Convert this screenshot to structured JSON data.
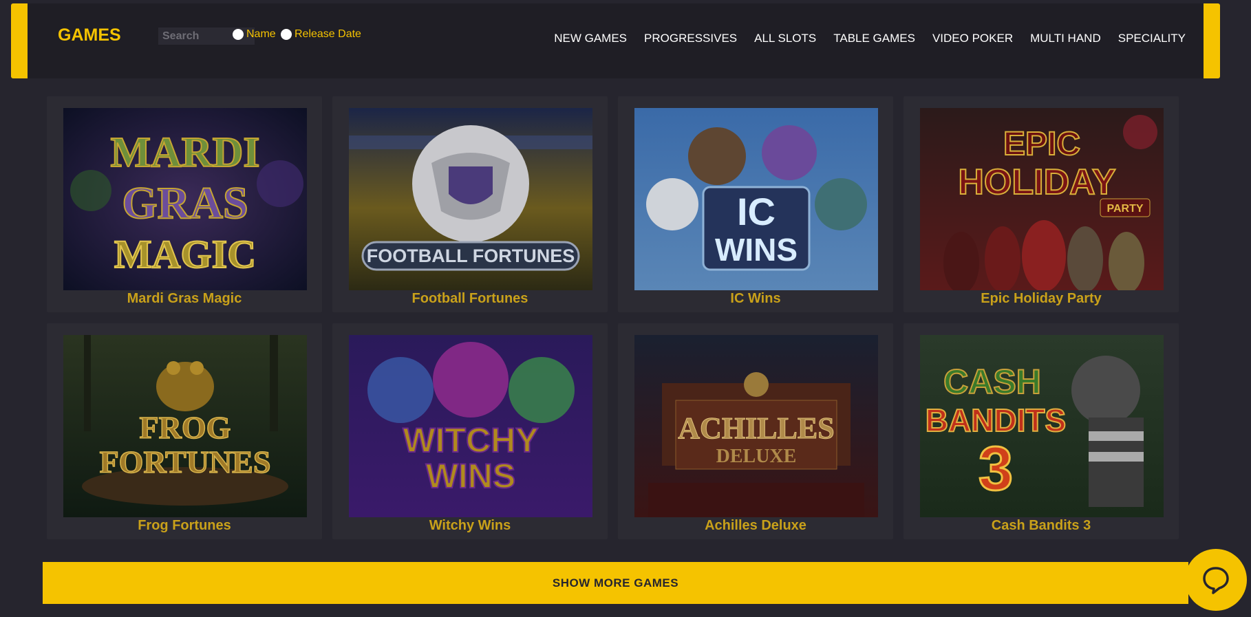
{
  "header": {
    "brand": "GAMES",
    "search_placeholder": "Search",
    "sort_options": [
      {
        "label": "Name"
      },
      {
        "label": "Release Date"
      }
    ],
    "nav": [
      "NEW GAMES",
      "PROGRESSIVES",
      "ALL SLOTS",
      "TABLE GAMES",
      "VIDEO POKER",
      "MULTI HAND",
      "SPECIALITY"
    ]
  },
  "games": [
    {
      "title": "Mardi Gras Magic",
      "art": [
        "MARDI",
        "GRAS",
        "MAGIC"
      ]
    },
    {
      "title": "Football Fortunes",
      "art": [
        "FOOTBALL FORTUNES"
      ]
    },
    {
      "title": "IC Wins",
      "art": [
        "IC",
        "WINS"
      ]
    },
    {
      "title": "Epic Holiday Party",
      "art": [
        "EPIC",
        "HOLIDAY",
        "PARTY"
      ]
    },
    {
      "title": "Frog Fortunes",
      "art": [
        "FROG",
        "FORTUNES"
      ]
    },
    {
      "title": "Witchy Wins",
      "art": [
        "WITCHY",
        "WINS"
      ]
    },
    {
      "title": "Achilles Deluxe",
      "art": [
        "ACHILLES",
        "DELUXE"
      ]
    },
    {
      "title": "Cash Bandits 3",
      "art": [
        "CASH",
        "BANDITS",
        "3"
      ]
    }
  ],
  "show_more_label": "SHOW MORE GAMES",
  "colors": {
    "accent": "#f5c300",
    "background": "#26252e",
    "card": "#2c2b33",
    "title": "#c9a11a"
  }
}
